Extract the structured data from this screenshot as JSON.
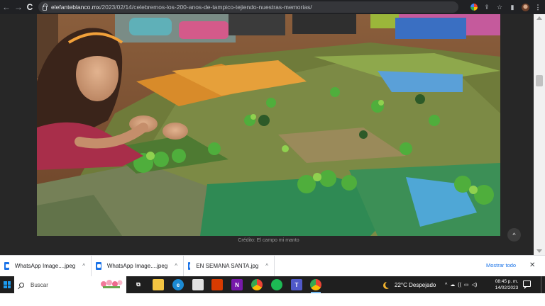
{
  "browser": {
    "url_host": "elefanteblanco.mx",
    "url_path": "/2023/02/14/celebremos-los-200-anos-de-tampico-tejiendo-nuestras-memorias/",
    "nav": {
      "back": "←",
      "forward": "→",
      "reload": "C"
    },
    "toolbar_glyphs": {
      "share": "⇪",
      "star": "☆",
      "sidepanel": "▮",
      "menu": "⋮"
    }
  },
  "article": {
    "photo_subject": "girl-with-knitted-landscape",
    "caption": "Crédito: El campo mi manto",
    "scroll_top_glyph": "^"
  },
  "downloads": {
    "items": [
      {
        "name": "WhatsApp Image....jpeg",
        "chevron": "^"
      },
      {
        "name": "WhatsApp Image....jpeg",
        "chevron": "^"
      },
      {
        "name": "EN SEMANA SANTA.jpg",
        "chevron": "^"
      }
    ],
    "show_all": "Mostrar todo",
    "close": "✕"
  },
  "taskbar": {
    "search_placeholder": "Buscar",
    "apps": [
      {
        "name": "task-view",
        "glyph": "⧉",
        "color": "#1f1f1f"
      },
      {
        "name": "file-explorer",
        "glyph": "",
        "color": "#f4c542"
      },
      {
        "name": "edge",
        "glyph": "e",
        "color": "#1b8ad3"
      },
      {
        "name": "store",
        "glyph": "",
        "color": "#e0e0e0"
      },
      {
        "name": "office",
        "glyph": "",
        "color": "#d83b01"
      },
      {
        "name": "onenote",
        "glyph": "N",
        "color": "#7719aa"
      },
      {
        "name": "chrome",
        "glyph": "",
        "color": "#ea4335"
      },
      {
        "name": "spotify",
        "glyph": "",
        "color": "#1db954"
      },
      {
        "name": "teams",
        "glyph": "T",
        "color": "#5059c9"
      },
      {
        "name": "chrome-active",
        "glyph": "",
        "color": "#ea4335"
      }
    ],
    "weather": "22°C  Despejado",
    "tray_glyphs": {
      "chevron": "^",
      "cloud": "☁",
      "wifi": "((",
      "battery": "▭",
      "volume": "◁)"
    },
    "time": "08:45 p. m.",
    "date": "14/02/2023"
  }
}
